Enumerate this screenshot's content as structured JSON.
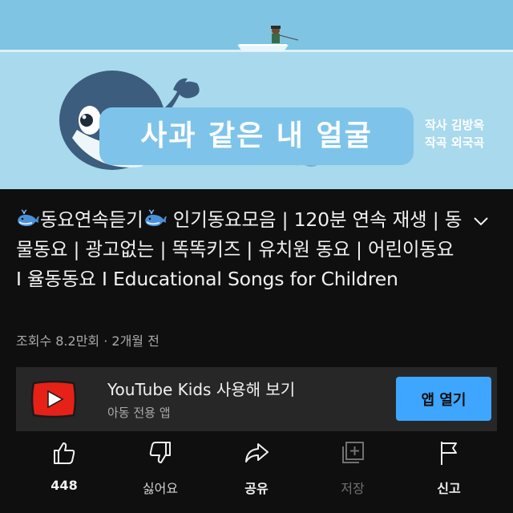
{
  "thumbnail": {
    "title_card": "사과 같은 내 얼굴",
    "credits": [
      "작사 김방옥",
      "작곡 외국곡"
    ],
    "colors": {
      "sky": "#7fc4e2",
      "sea": "#a9d9ec",
      "whale": "#3c5d7e",
      "card": "#7ec4ea"
    }
  },
  "video": {
    "title_part1": "동요연속듣기",
    "title_part2": " 인기동요모음 | 120분 연속 재생 | 동물동요 | 광고없는 | 똑똑키즈 | 유치원 동요 | 어린이동요 I 율동동요 I Educational Songs for Children",
    "title_emoji": "whale-emoji",
    "meta": "조회수 8.2만회 · 2개월 전"
  },
  "kids_banner": {
    "title": "YouTube Kids 사용해 보기",
    "subtitle": "아동 전용 앱",
    "button_label": "앱 열기",
    "button_color": "#3ea6ff"
  },
  "actions": {
    "like": {
      "label": "448",
      "icon": "thumbs-up-icon"
    },
    "dislike": {
      "label": "싫어요",
      "icon": "thumbs-down-icon"
    },
    "share": {
      "label": "공유",
      "icon": "share-icon"
    },
    "save": {
      "label": "저장",
      "icon": "add-to-playlist-icon",
      "disabled": true
    },
    "report": {
      "label": "신고",
      "icon": "flag-icon"
    }
  }
}
